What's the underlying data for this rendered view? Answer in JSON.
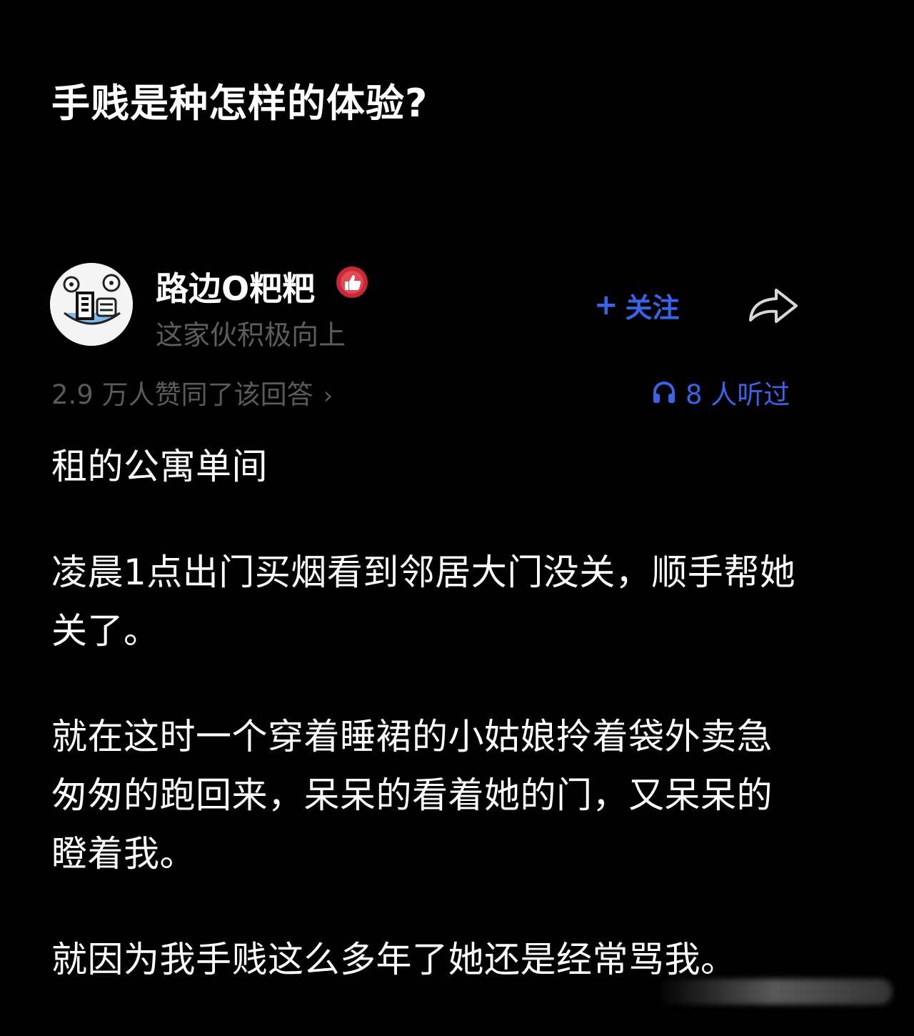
{
  "question": {
    "title": "手贱是种怎样的体验?"
  },
  "author": {
    "name": "路边O粑粑",
    "bio": "这家伙积极向上",
    "avatar_icon": "cartoon-avatar",
    "badge_icon": "thumbs-up-badge-icon"
  },
  "actions": {
    "follow_label": "关注",
    "follow_prefix": "+",
    "share_icon": "share-arrow-icon"
  },
  "stats": {
    "approvals_text": "2.9 万人赞同了该回答",
    "chevron": "›",
    "listen_text": "8 人听过"
  },
  "answer": {
    "paragraphs": [
      "租的公寓单间",
      "凌晨1点出门买烟看到邻居大门没关，顺手帮她关了。",
      "就在这时一个穿着睡裙的小姑娘拎着袋外卖急匆匆的跑回来，呆呆的看着她的门，又呆呆的瞪着我。",
      "就因为我手贱这么多年了她还是经常骂我。"
    ]
  },
  "colors": {
    "background": "#000000",
    "text_primary": "#ffffff",
    "text_muted": "#5a5a5a",
    "accent_blue": "#3a63e8",
    "badge_red": "#c8283a"
  }
}
